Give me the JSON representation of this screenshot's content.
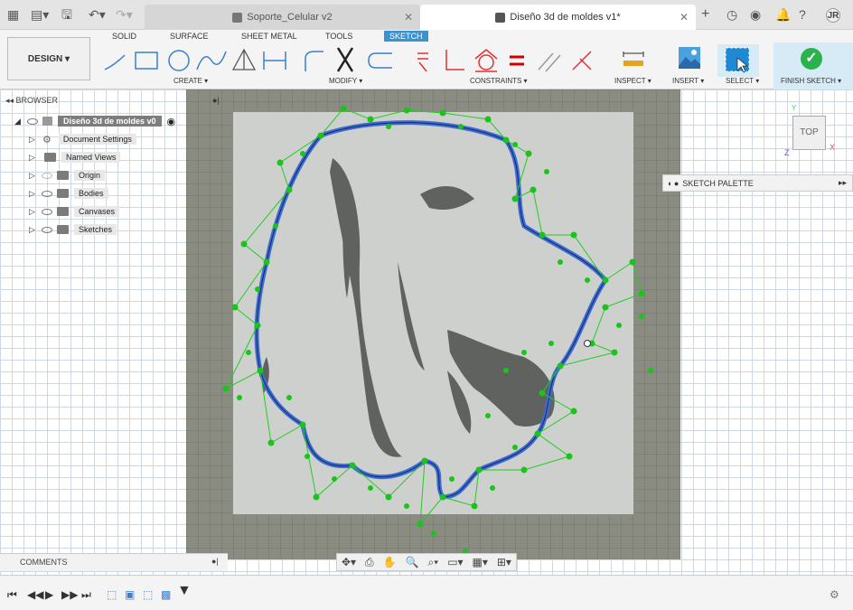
{
  "tabs": {
    "t1": "Soporte_Celular v2",
    "t2": "Diseño 3d de moldes v1*"
  },
  "workspace_tabs": [
    "SOLID",
    "SURFACE",
    "SHEET METAL",
    "TOOLS",
    "SKETCH"
  ],
  "design": "DESIGN ▾",
  "groups": {
    "create": "CREATE ▾",
    "modify": "MODIFY ▾",
    "constraints": "CONSTRAINTS ▾",
    "inspect": "INSPECT ▾",
    "insert": "INSERT ▾",
    "select": "SELECT ▾",
    "finish": "FINISH SKETCH ▾"
  },
  "browser": {
    "title": "BROWSER",
    "root": "Diseño 3d de moldes v0",
    "items": [
      "Document Settings",
      "Named Views",
      "Origin",
      "Bodies",
      "Canvases",
      "Sketches"
    ]
  },
  "palette": "SKETCH PALETTE",
  "viewcube": "TOP",
  "axes": {
    "y": "Y",
    "x": "X",
    "z": "Z"
  },
  "comments": "COMMENTS",
  "user_initials": "JR",
  "colors": {
    "accent": "#3a92cf",
    "finish": "#2bb24c",
    "curve": "#3b6cd8",
    "constraint": "#1ac41a"
  }
}
